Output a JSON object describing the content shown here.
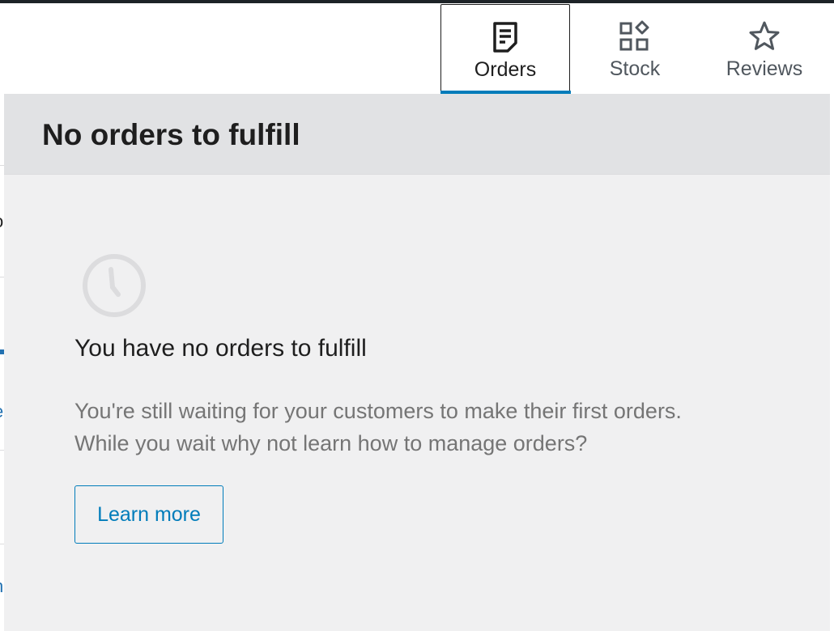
{
  "tabs": [
    {
      "label": "Orders",
      "icon": "orders-page-icon",
      "active": true
    },
    {
      "label": "Stock",
      "icon": "stock-blocks-icon",
      "active": false
    },
    {
      "label": "Reviews",
      "icon": "star-icon",
      "active": false
    }
  ],
  "panel": {
    "title": "No orders to fulfill",
    "empty_state": {
      "icon": "clock-icon",
      "heading": "You have no orders to fulfill",
      "description_line1": "You're still waiting for your customers to make their first orders.",
      "description_line2": "While you wait why not learn how to manage orders?",
      "button_label": "Learn more"
    }
  },
  "colors": {
    "accent": "#007cba",
    "header_bg": "#e1e2e4",
    "panel_bg": "#f0f0f1",
    "text_dark": "#1e1e1e",
    "text_muted": "#757575"
  }
}
